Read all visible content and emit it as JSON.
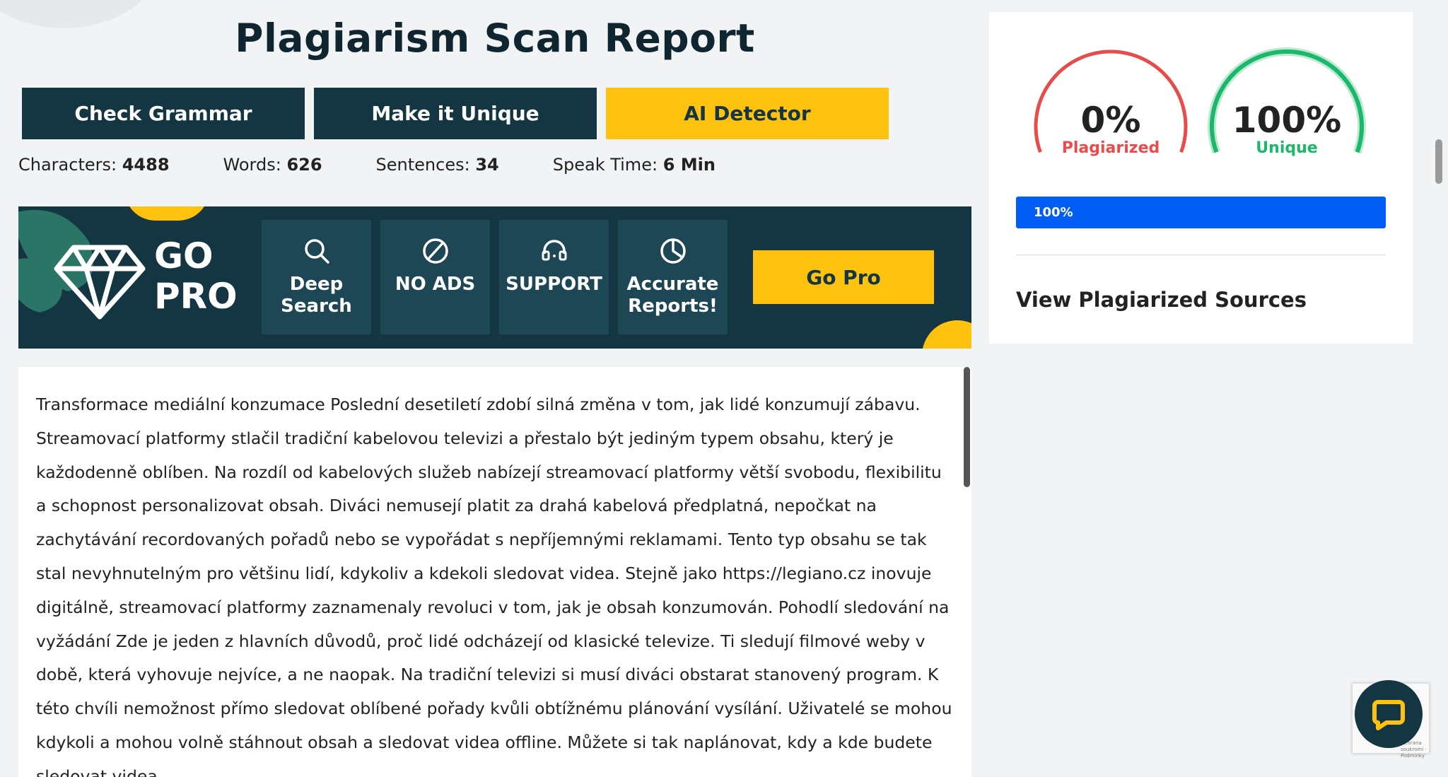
{
  "header": {
    "title": "Plagiarism Scan Report"
  },
  "tabs": [
    {
      "label": "Check Grammar"
    },
    {
      "label": "Make it Unique"
    },
    {
      "label": "AI Detector"
    }
  ],
  "stats": {
    "characters_label": "Characters:",
    "characters_value": "4488",
    "words_label": "Words:",
    "words_value": "626",
    "sentences_label": "Sentences:",
    "sentences_value": "34",
    "speak_label": "Speak Time:",
    "speak_value": "6 Min"
  },
  "promo": {
    "go": "GO",
    "pro": "PRO",
    "features": [
      {
        "line1": "Deep",
        "line2": "Search",
        "icon": "search-icon"
      },
      {
        "line1": "NO ADS",
        "line2": "",
        "icon": "no-ads-icon"
      },
      {
        "line1": "SUPPORT",
        "line2": "",
        "icon": "headset-icon"
      },
      {
        "line1": "Accurate",
        "line2": "Reports!",
        "icon": "pie-chart-icon"
      }
    ],
    "button_label": "Go Pro"
  },
  "content": {
    "text": "Transformace mediální konzumace Poslední desetiletí zdobí silná změna v tom, jak lidé konzumují zábavu. Streamovací platformy stlačil tradiční kabelovou televizi a přestalo být jediným typem obsahu, který je každodenně oblíben. Na rozdíl od kabelových služeb nabízejí streamovací platformy větší svobodu, flexibilitu a schopnost personalizovat obsah. Diváci nemusejí platit za drahá kabelová předplatná, nepočkat na zachytávání recordovaných pořadů nebo se vypořádat s nepříjemnými reklamami. Tento typ obsahu se tak stal nevyhnutelným pro většinu lidí, kdykoliv a kdekoli sledovat videa. Stejně jako https://legiano.cz inovuje digitálně, streamovací platformy zaznamenaly revoluci v tom, jak je obsah konzumován. Pohodlí sledování na vyžádání Zde je jeden z hlavních důvodů, proč lidé odcházejí od klasické televize. Ti sledují filmové weby v době, která vyhovuje nejvíce, a ne naopak. Na tradiční televizi si musí diváci obstarat stanovený program. K této chvíli nemožnost přímo sledovat oblíbené pořady kvůli obtížnému plánování vysílání. Uživatelé se mohou kdykoli a mohou volně stáhnout obsah a sledovat videa offline. Můžete si tak naplánovat, kdy a kde budete sledovat videa"
  },
  "results": {
    "plagiarized_pct": "0%",
    "plagiarized_label": "Plagiarized",
    "plagiarized_value": 0,
    "unique_pct": "100%",
    "unique_label": "Unique",
    "unique_value": 100,
    "progress_label": "100%",
    "progress_value": 1.0,
    "sources_title": "View Plagiarized Sources"
  },
  "colors": {
    "navy": "#143642",
    "yellow": "#ffc20e",
    "red": "#e94b4b",
    "green": "#1ab86a",
    "blue": "#005ef5"
  },
  "widgets": {
    "chat_icon": "chat-icon",
    "recaptcha_text": "Ochrana soukromí · Podmínky"
  }
}
